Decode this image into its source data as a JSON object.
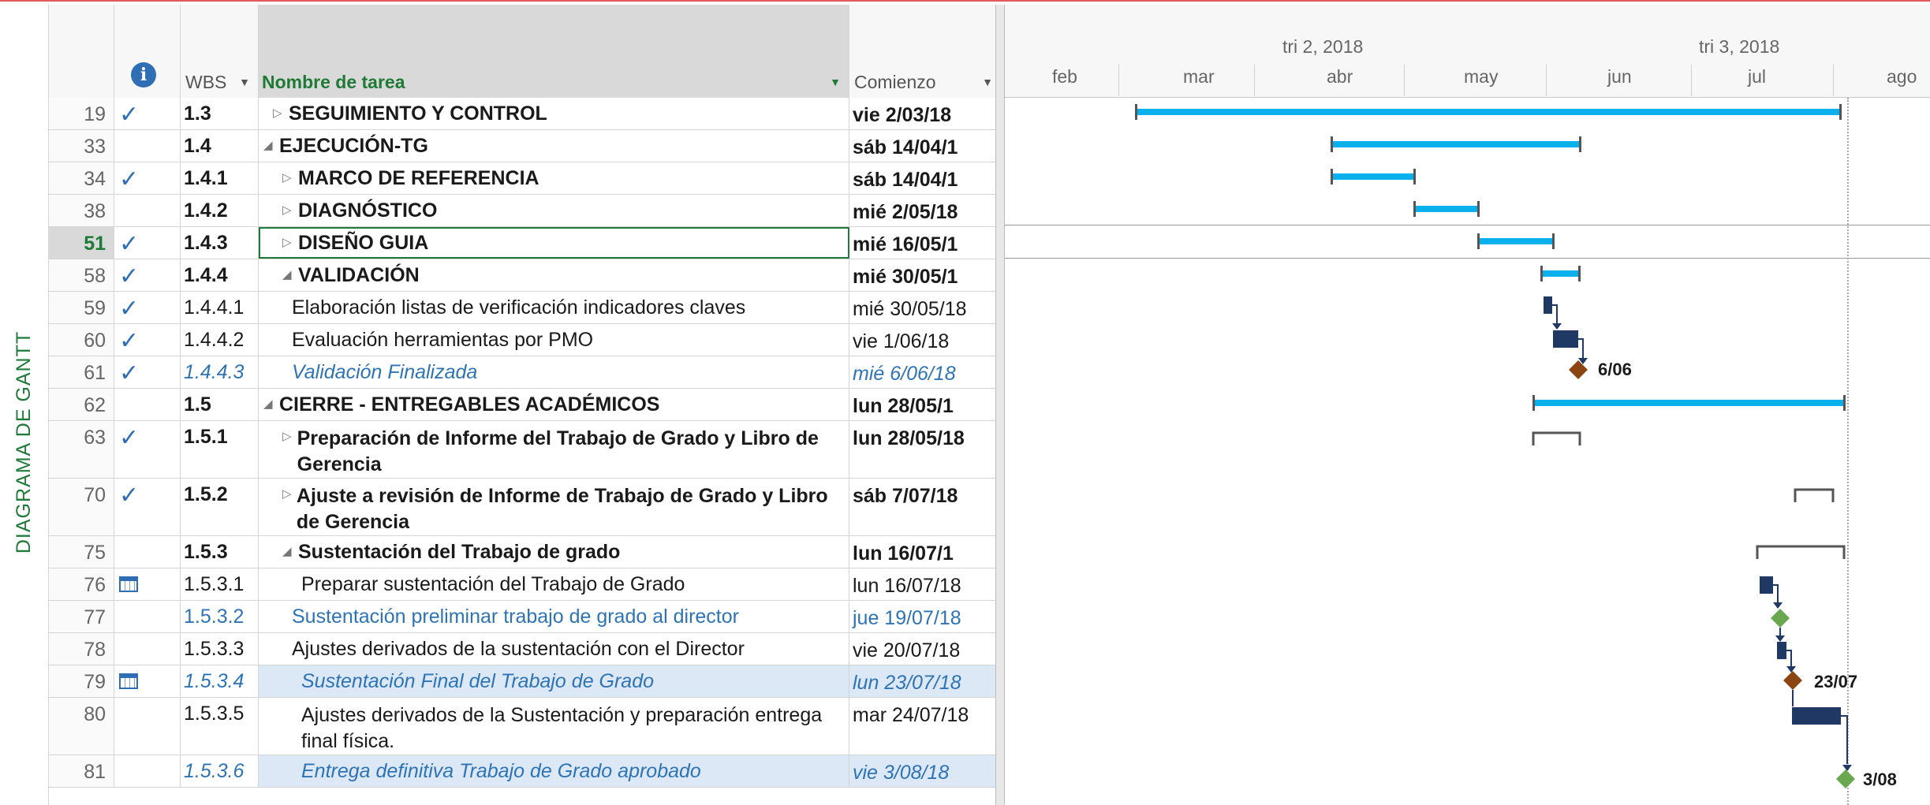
{
  "view_label": "DIAGRAMA DE GANTT",
  "columns": {
    "wbs": "WBS",
    "name": "Nombre de tarea",
    "start": "Comienzo"
  },
  "timescale": {
    "quarters": [
      "tri 2, 2018",
      "tri 3, 2018"
    ],
    "months": [
      "feb",
      "mar",
      "abr",
      "may",
      "jun",
      "jul",
      "ago"
    ]
  },
  "colors": {
    "summary_bar": "#0ab0ec",
    "task_bar": "#1f3864",
    "milestone": "#8b4513",
    "green_milestone": "#6aa84f",
    "header_green": "#217a3c"
  },
  "rows": [
    {
      "id": "19",
      "ind": "check",
      "wbs": "1.3",
      "name": "SEGUIMIENTO Y CONTROL",
      "start": "vie 2/03/18",
      "style": "b",
      "indent": 1,
      "toggle": "▷"
    },
    {
      "id": "33",
      "ind": "",
      "wbs": "1.4",
      "name": "EJECUCIÓN-TG",
      "start": "sáb 14/04/1",
      "style": "b",
      "indent": 0,
      "toggle": "◢"
    },
    {
      "id": "34",
      "ind": "check",
      "wbs": "1.4.1",
      "name": "MARCO DE REFERENCIA",
      "start": "sáb 14/04/1",
      "style": "b",
      "indent": 2,
      "toggle": "▷"
    },
    {
      "id": "38",
      "ind": "",
      "wbs": "1.4.2",
      "name": "DIAGNÓSTICO",
      "start": "mié 2/05/18",
      "style": "b",
      "indent": 2,
      "toggle": "▷"
    },
    {
      "id": "51",
      "ind": "check",
      "wbs": "1.4.3",
      "name": "DISEÑO GUIA",
      "start": "mié 16/05/1",
      "style": "b",
      "indent": 2,
      "toggle": "▷"
    },
    {
      "id": "58",
      "ind": "check",
      "wbs": "1.4.4",
      "name": "VALIDACIÓN",
      "start": "mié 30/05/1",
      "style": "b",
      "indent": 2,
      "toggle": "◢"
    },
    {
      "id": "59",
      "ind": "check",
      "wbs": "1.4.4.1",
      "name": "Elaboración listas de verificación indicadores claves",
      "start": "mié 30/05/18",
      "style": "n",
      "indent": 3,
      "toggle": ""
    },
    {
      "id": "60",
      "ind": "check",
      "wbs": "1.4.4.2",
      "name": "Evaluación herramientas por PMO",
      "start": "vie 1/06/18",
      "style": "n",
      "indent": 3,
      "toggle": ""
    },
    {
      "id": "61",
      "ind": "check",
      "wbs": "1.4.4.3",
      "name": "Validación Finalizada",
      "start": "mié 6/06/18",
      "style": "m",
      "indent": 3,
      "toggle": ""
    },
    {
      "id": "62",
      "ind": "",
      "wbs": "1.5",
      "name": "CIERRE - ENTREGABLES ACADÉMICOS",
      "start": "lun 28/05/1",
      "style": "b",
      "indent": 0,
      "toggle": "◢"
    },
    {
      "id": "63",
      "ind": "check",
      "wbs": "1.5.1",
      "name": "Preparación de Informe del Trabajo de Grado y Libro de Gerencia",
      "start": "lun 28/05/18",
      "style": "b",
      "indent": 2,
      "toggle": "▷",
      "tall": true
    },
    {
      "id": "70",
      "ind": "check",
      "wbs": "1.5.2",
      "name": "Ajuste a revisión de Informe de Trabajo de Grado y Libro de Gerencia",
      "start": "sáb 7/07/18",
      "style": "b",
      "indent": 2,
      "toggle": "▷",
      "tall": true
    },
    {
      "id": "75",
      "ind": "",
      "wbs": "1.5.3",
      "name": "Sustentación del Trabajo de grado",
      "start": "lun 16/07/1",
      "style": "b",
      "indent": 2,
      "toggle": "◢"
    },
    {
      "id": "76",
      "ind": "cal",
      "wbs": "1.5.3.1",
      "name": "Preparar sustentación del Trabajo de Grado",
      "start": "lun 16/07/18",
      "style": "n",
      "indent": 4,
      "toggle": ""
    },
    {
      "id": "77",
      "ind": "",
      "wbs": "1.5.3.2",
      "name": "Sustentación preliminar trabajo de grado al director",
      "start": "jue 19/07/18",
      "style": "l",
      "indent": 3,
      "toggle": ""
    },
    {
      "id": "78",
      "ind": "",
      "wbs": "1.5.3.3",
      "name": "Ajustes derivados de la sustentación con el Director",
      "start": "vie 20/07/18",
      "style": "n",
      "indent": 3,
      "toggle": ""
    },
    {
      "id": "79",
      "ind": "cal",
      "wbs": "1.5.3.4",
      "name": "Sustentación Final del Trabajo de Grado",
      "start": "lun 23/07/18",
      "style": "m",
      "indent": 4,
      "toggle": "",
      "hl": true
    },
    {
      "id": "80",
      "ind": "",
      "wbs": "1.5.3.5",
      "name": "Ajustes derivados de la Sustentación y preparación entrega final física.",
      "start": "mar 24/07/18",
      "style": "n",
      "indent": 4,
      "toggle": "",
      "tall": true
    },
    {
      "id": "81",
      "ind": "",
      "wbs": "1.5.3.6",
      "name": "Entrega definitiva Trabajo de Grado aprobado",
      "start": "vie 3/08/18",
      "style": "m",
      "indent": 4,
      "toggle": "",
      "hl": true
    }
  ],
  "selected_row": "51",
  "milestone_labels": [
    "6/06",
    "23/07",
    "3/08"
  ]
}
